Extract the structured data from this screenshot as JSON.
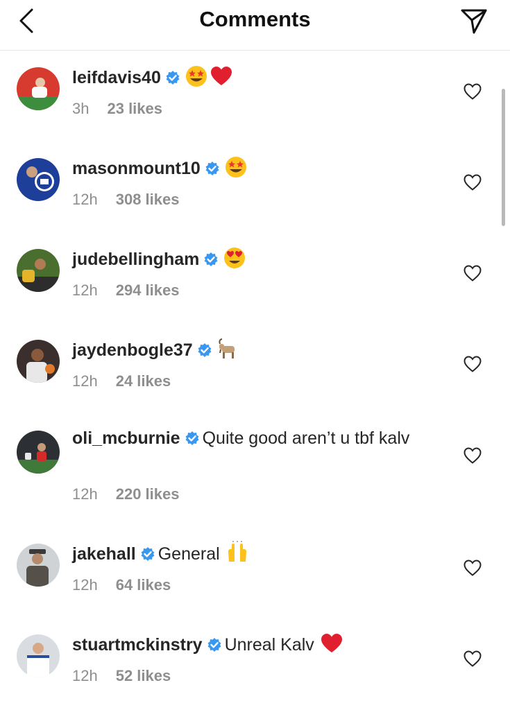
{
  "header": {
    "title": "Comments",
    "back_icon": "chevron-left-icon",
    "share_icon": "paper-plane-icon"
  },
  "colors": {
    "verified": "#3897f0",
    "meta": "#8e8e8e",
    "text": "#262626"
  },
  "comments": [
    {
      "username": "leifdavis40",
      "verified": true,
      "text": "",
      "emojis": [
        "star-struck-emoji",
        "red-heart-emoji"
      ],
      "time": "3h",
      "likes": "23 likes"
    },
    {
      "username": "masonmount10",
      "verified": true,
      "text": "",
      "emojis": [
        "star-struck-emoji"
      ],
      "time": "12h",
      "likes": "308 likes"
    },
    {
      "username": "judebellingham",
      "verified": true,
      "text": "",
      "emojis": [
        "heart-eyes-emoji"
      ],
      "time": "12h",
      "likes": "294 likes"
    },
    {
      "username": "jaydenbogle37",
      "verified": true,
      "text": "",
      "emojis": [
        "goat-emoji"
      ],
      "time": "12h",
      "likes": "24 likes"
    },
    {
      "username": "oli_mcburnie",
      "verified": true,
      "text": "Quite good aren’t u tbf kalv",
      "emojis": [],
      "time": "12h",
      "likes": "220 likes"
    },
    {
      "username": "jakehall",
      "verified": true,
      "text": "General",
      "emojis": [
        "raising-hands-emoji"
      ],
      "time": "12h",
      "likes": "64 likes"
    },
    {
      "username": "stuartmckinstry",
      "verified": true,
      "text": "Unreal Kalv",
      "emojis": [
        "red-heart-emoji"
      ],
      "time": "12h",
      "likes": "52 likes"
    }
  ]
}
